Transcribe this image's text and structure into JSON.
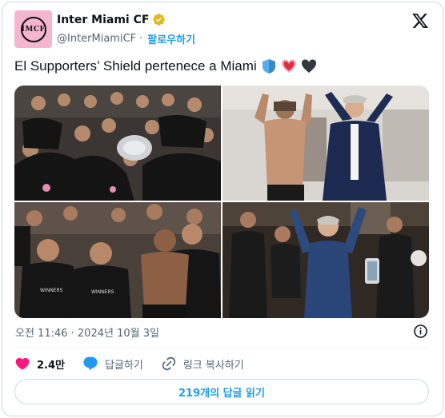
{
  "account": {
    "name": "Inter Miami CF",
    "handle": "@InterMiamiCF",
    "separator": "·",
    "follow_label": "팔로우하기",
    "avatar_alt": "Inter Miami CF crest",
    "avatar_text": "IMCF",
    "brand_color": "#f5b6cd"
  },
  "tweet": {
    "text": "El Supporters’ Shield pertenece a Miami",
    "emojis": [
      "blue-shield",
      "pink-heart",
      "black-heart"
    ]
  },
  "media": {
    "photos": [
      {
        "name": "team-celebration-trophy"
      },
      {
        "name": "players-celebrating-locker-room"
      },
      {
        "name": "players-posing-winners-shirts"
      },
      {
        "name": "owner-lifted-by-players"
      }
    ]
  },
  "meta": {
    "timestamp": "오전 11:46 · 2024년 10월 3일"
  },
  "actions": {
    "likes_count": "2.4만",
    "reply_label": "답글하기",
    "copy_link_label": "링크 복사하기"
  },
  "footer": {
    "read_replies_label": "219개의 답글 읽기"
  },
  "colors": {
    "accent": "#1d9bf0",
    "like": "#f91880",
    "text_secondary": "#536471"
  }
}
